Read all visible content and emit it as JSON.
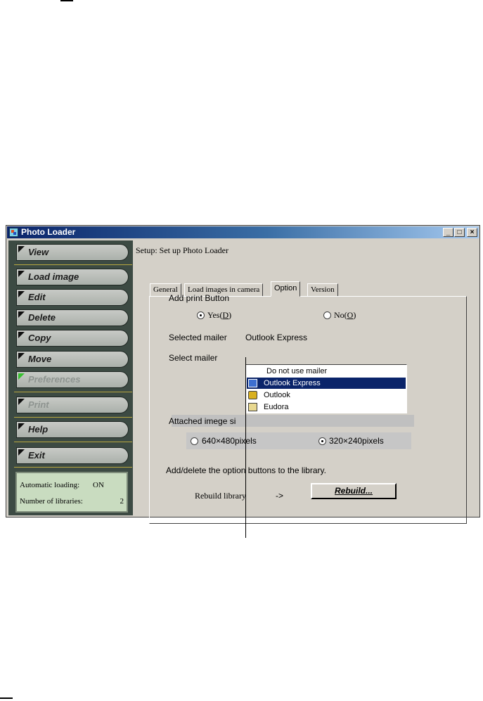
{
  "window": {
    "title": "Photo Loader",
    "minimize": "_",
    "maximize": "□",
    "close": "×"
  },
  "sidebar": {
    "items": [
      {
        "label": "View",
        "state": "normal"
      },
      {
        "label": "Load image",
        "state": "normal"
      },
      {
        "label": "Edit",
        "state": "normal"
      },
      {
        "label": "Delete",
        "state": "normal"
      },
      {
        "label": "Copy",
        "state": "normal"
      },
      {
        "label": "Move",
        "state": "normal"
      },
      {
        "label": "Preferences",
        "state": "active"
      },
      {
        "label": "Print",
        "state": "disabled"
      },
      {
        "label": "Help",
        "state": "normal"
      },
      {
        "label": "Exit",
        "state": "normal"
      }
    ],
    "status": {
      "auto_loading_label": "Automatic loading:",
      "auto_loading_value": "ON",
      "libraries_label": "Number of libraries:",
      "libraries_value": "2"
    }
  },
  "main": {
    "setup_title": "Setup: Set up Photo Loader",
    "tabs": [
      {
        "label": "General",
        "active": false
      },
      {
        "label": "Load images in camera",
        "active": false
      },
      {
        "label": "Option",
        "active": true
      },
      {
        "label": "Version",
        "active": false
      }
    ],
    "option": {
      "print_button_label": "Add print Button",
      "yes_label": "Yes(",
      "yes_key": "D",
      "yes_close": ")",
      "no_label": "No(",
      "no_key": "O",
      "no_close": ")",
      "print_selected": "yes",
      "selected_mailer_label": "Selected mailer",
      "selected_mailer_value": "Outlook Express",
      "select_mailer_label": "Select mailer",
      "mailer_options": [
        {
          "label": "Do not use mailer",
          "icon": "none-icon",
          "selected": false
        },
        {
          "label": "Outlook Express",
          "icon": "outlook-express-icon",
          "selected": true
        },
        {
          "label": "Outlook",
          "icon": "outlook-icon",
          "selected": false
        },
        {
          "label": "Eudora",
          "icon": "eudora-icon",
          "selected": false
        }
      ],
      "attached_image_label": "Attached imege si",
      "size_640_label": "640×480pi",
      "size_640_tail": "xels",
      "size_320_label": "320×240pixels",
      "size_selected": "320x240",
      "library_text_a": "Add/delete the optio",
      "library_text_b": "n buttons to the library.",
      "rebuild_label": "Rebuild library",
      "arrow": "->",
      "rebuild_button": "Rebuild..."
    }
  },
  "colors": {
    "titlebar": "#0a246a",
    "selection": "#0a246a",
    "sidebar_bg": "#3c4a43",
    "status_bg": "#c9dcc0"
  }
}
